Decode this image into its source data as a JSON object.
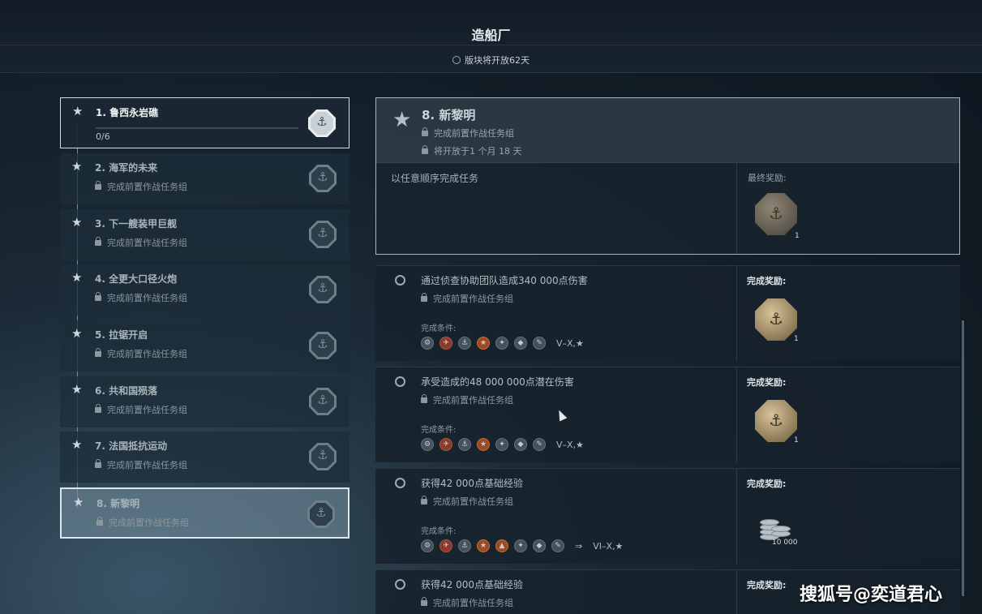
{
  "header": {
    "title": "造船厂",
    "subtitle": "版块将开放62天"
  },
  "stages": [
    {
      "star": "★",
      "name": "1. 鲁西永岩礁",
      "progress": "0/6",
      "progress_fraction": 0.0
    },
    {
      "star": "★",
      "name": "2. 海军的未来",
      "lock_text": "完成前置作战任务组"
    },
    {
      "star": "★",
      "name": "3. 下一艘装甲巨舰",
      "lock_text": "完成前置作战任务组"
    },
    {
      "star": "★",
      "name": "4. 全更大口径火炮",
      "lock_text": "完成前置作战任务组"
    },
    {
      "star": "★",
      "name": "5. 拉锯开启",
      "lock_text": "完成前置作战任务组"
    },
    {
      "star": "★",
      "name": "6. 共和国殒落",
      "lock_text": "完成前置作战任务组"
    },
    {
      "star": "★",
      "name": "7. 法国抵抗运动",
      "lock_text": "完成前置作战任务组"
    },
    {
      "star": "★",
      "name": "8. 新黎明",
      "lock_text": "完成前置作战任务组"
    }
  ],
  "detail": {
    "star": "★",
    "name": "8. 新黎明",
    "line1": "完成前置作战任务组",
    "line2": "将开放于1 个月 18 天",
    "order_text": "以任意顺序完成任务",
    "final_reward_label": "最终奖励:",
    "final_reward_count": "1"
  },
  "tasks": [
    {
      "name": "通过侦查协助团队造成340 000点伤害",
      "lock_text": "完成前置作战任务组",
      "cond_label": "完成条件:",
      "tier": "V–X,★",
      "reward_label": "完成奖励:",
      "reward_count": "1"
    },
    {
      "name": "承受造成的48 000 000点潜在伤害",
      "lock_text": "完成前置作战任务组",
      "cond_label": "完成条件:",
      "tier": "V–X,★",
      "reward_label": "完成奖励:",
      "reward_count": "1"
    },
    {
      "name": "获得42 000点基础经验",
      "lock_text": "完成前置作战任务组",
      "cond_label": "完成条件:",
      "tier": "VI–X,★",
      "reward_label": "完成奖励:",
      "reward_count": "10 000"
    },
    {
      "name": "获得42 000点基础经验",
      "lock_text": "完成前置作战任务组",
      "reward_label": "完成奖励:"
    }
  ],
  "icons": {
    "star": "star-icon",
    "lock": "lock-icon",
    "clock": "clock-icon",
    "badge": "shipyard-badge-icon",
    "coin": "reward-coin-icon",
    "credits": "credits-icon",
    "arrow": "⇒"
  },
  "watermark": "搜狐号@奕道君心"
}
